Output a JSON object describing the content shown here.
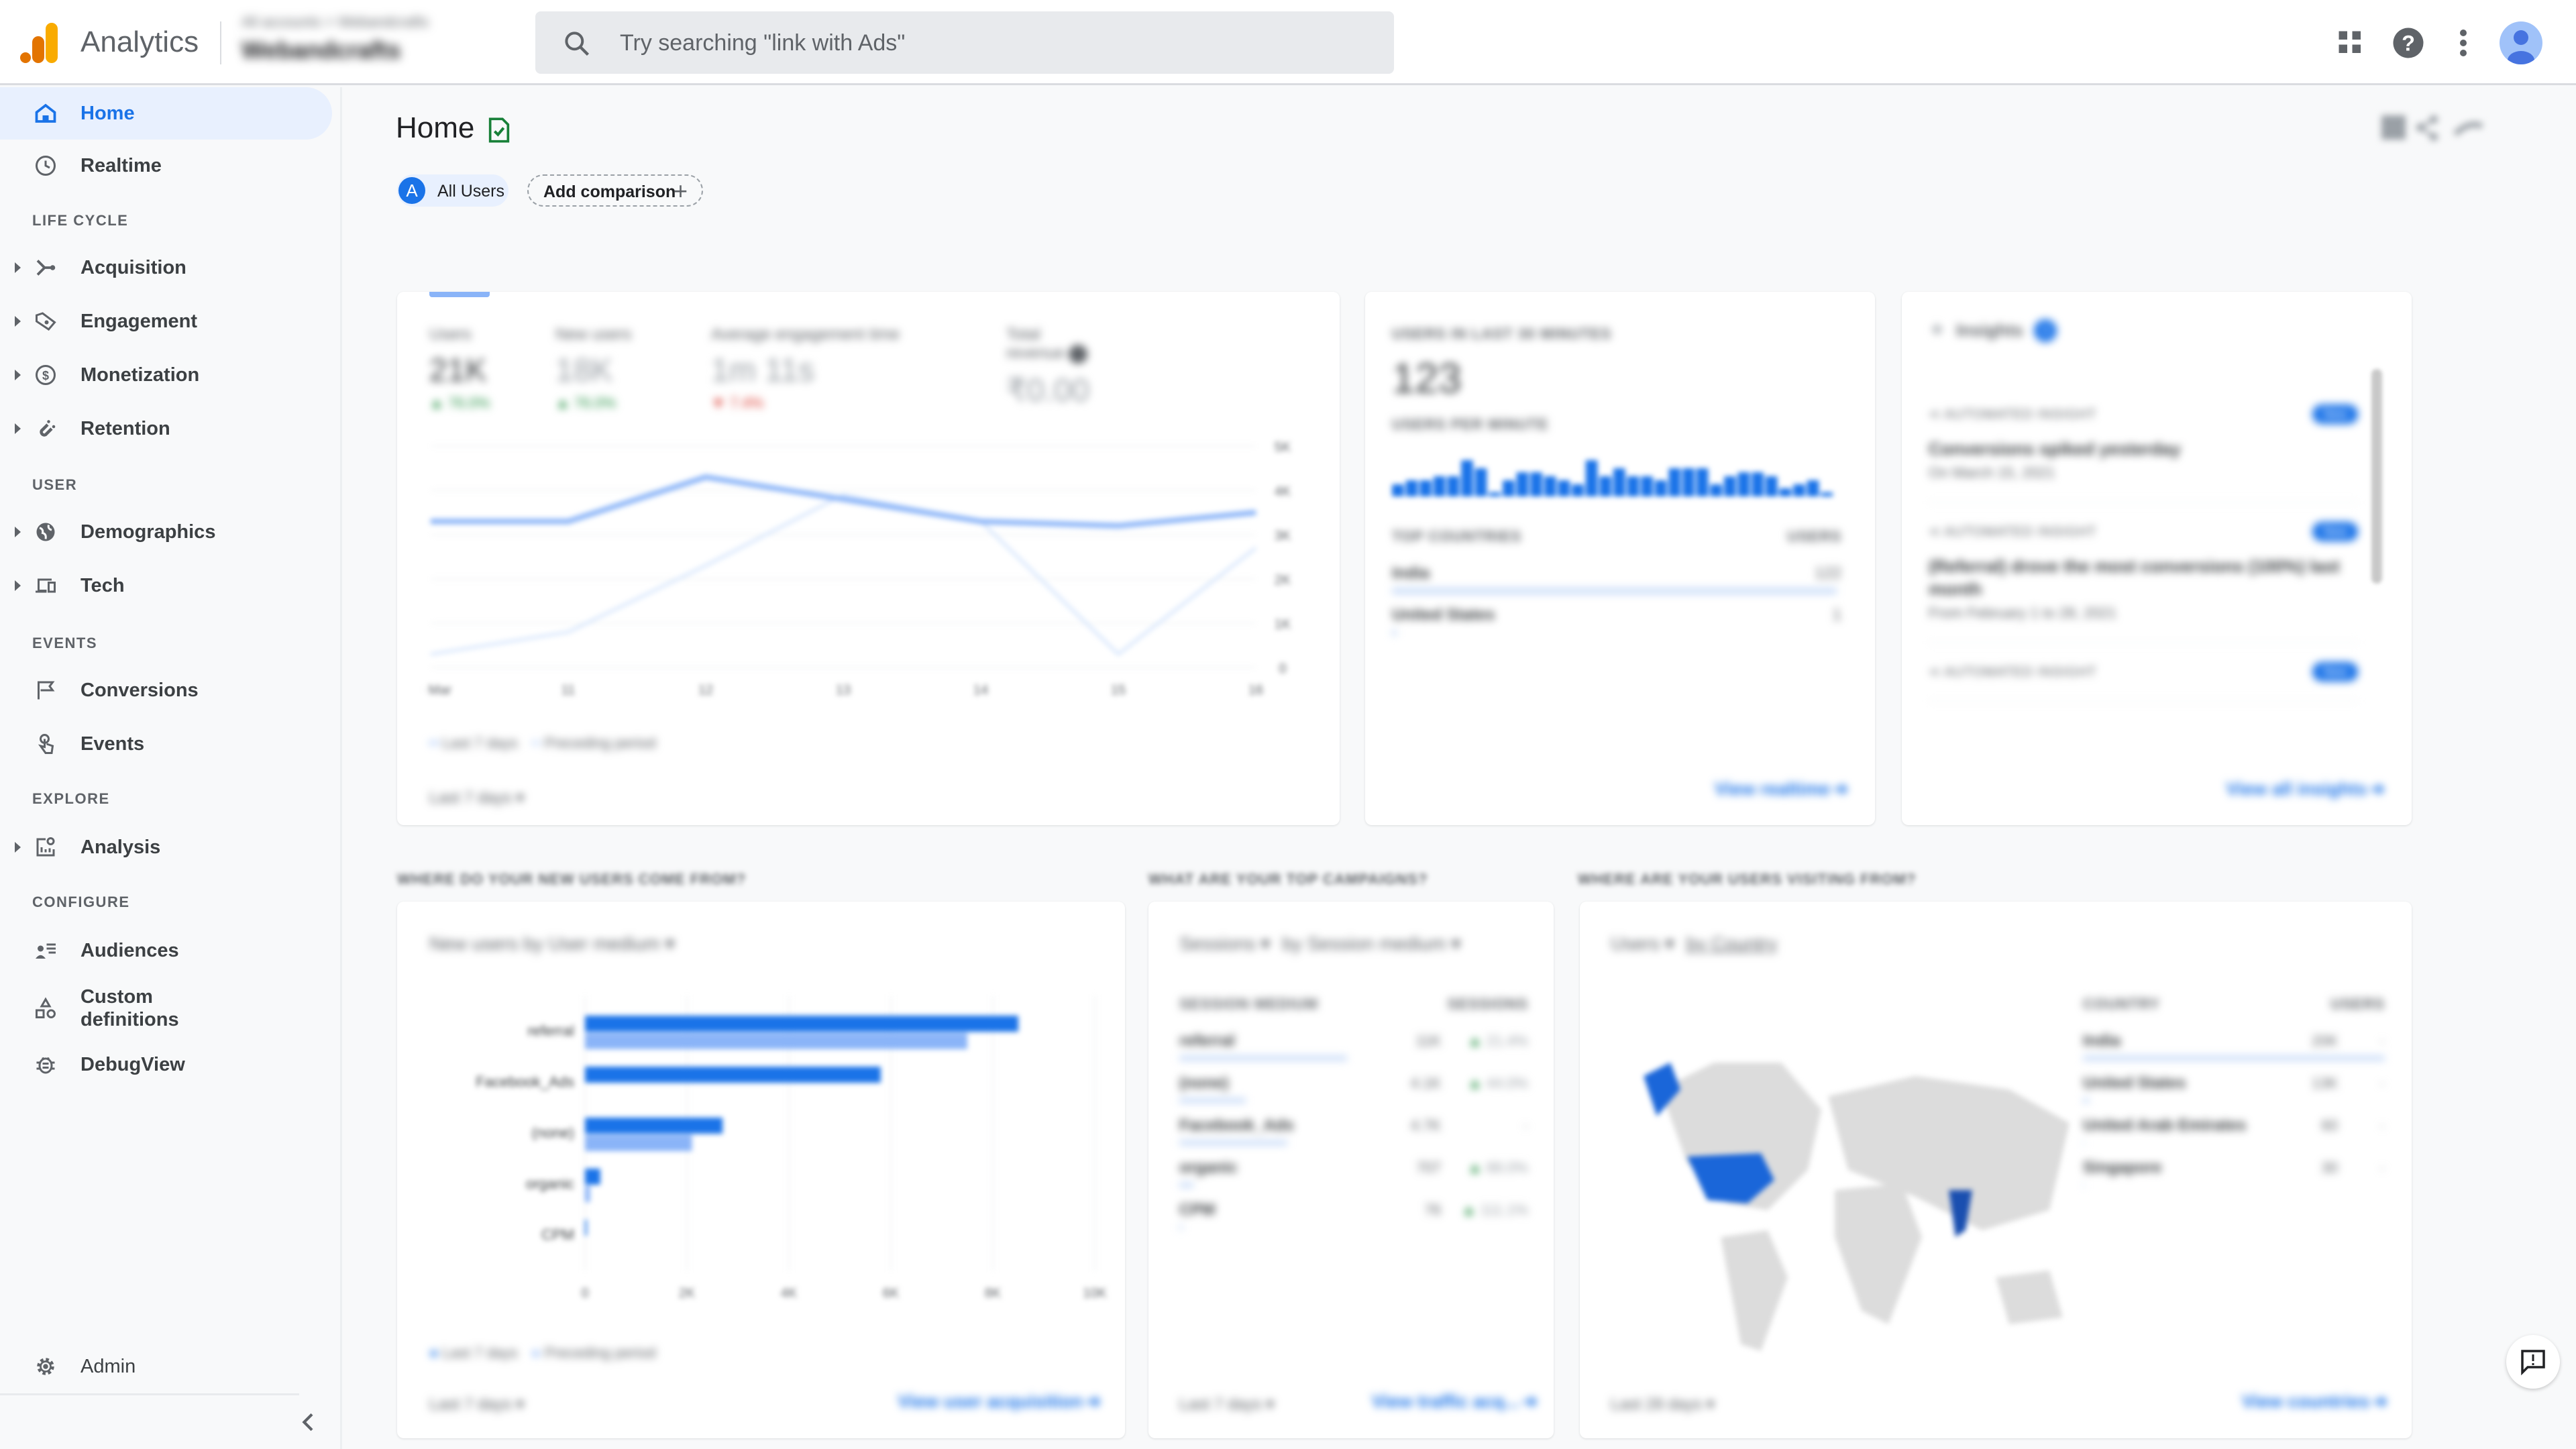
{
  "topbar": {
    "app_name": "Analytics",
    "account_path": "All accounts > Webandcrafts",
    "property_name": "Webandcrafts",
    "search_placeholder": "Try searching \"link with Ads\"",
    "icons": [
      "apps-grid-icon",
      "help-icon",
      "more-vert-icon",
      "account-avatar-icon"
    ]
  },
  "sidebar": {
    "items": [
      {
        "label": "Home",
        "icon": "home-icon",
        "active": true,
        "expandable": false
      },
      {
        "label": "Realtime",
        "icon": "clock-icon",
        "expandable": false
      }
    ],
    "sections": [
      {
        "heading": "LIFE CYCLE",
        "items": [
          {
            "label": "Acquisition",
            "icon": "acquisition-icon",
            "expandable": true
          },
          {
            "label": "Engagement",
            "icon": "tag-heart-icon",
            "expandable": true
          },
          {
            "label": "Monetization",
            "icon": "dollar-icon",
            "expandable": true
          },
          {
            "label": "Retention",
            "icon": "magnet-icon",
            "expandable": true
          }
        ]
      },
      {
        "heading": "USER",
        "items": [
          {
            "label": "Demographics",
            "icon": "globe-icon",
            "expandable": true
          },
          {
            "label": "Tech",
            "icon": "devices-icon",
            "expandable": true
          }
        ]
      },
      {
        "heading": "EVENTS",
        "items": [
          {
            "label": "Conversions",
            "icon": "flag-icon",
            "expandable": false
          },
          {
            "label": "Events",
            "icon": "touch-icon",
            "expandable": false
          }
        ]
      },
      {
        "heading": "EXPLORE",
        "items": [
          {
            "label": "Analysis",
            "icon": "analysis-icon",
            "expandable": true
          }
        ]
      },
      {
        "heading": "CONFIGURE",
        "items": [
          {
            "label": "Audiences",
            "icon": "audiences-icon",
            "expandable": false
          },
          {
            "label": "Custom definitions",
            "icon": "shapes-icon",
            "expandable": false
          },
          {
            "label": "DebugView",
            "icon": "bug-icon",
            "expandable": false
          }
        ]
      }
    ],
    "admin_label": "Admin"
  },
  "main": {
    "title": "Home",
    "segment_chip": {
      "letter": "A",
      "label": "All Users"
    },
    "add_comparison_label": "Add comparison",
    "overview_card": {
      "metrics": [
        {
          "label": "Users",
          "value": "21K",
          "change": "76.0%",
          "direction": "up"
        },
        {
          "label": "New users",
          "value": "18K",
          "change": "76.0%",
          "direction": "up"
        },
        {
          "label": "Average engagement time",
          "value": "1m 11s",
          "change": "7.4%",
          "direction": "down"
        },
        {
          "label": "Total revenue",
          "value": "₹0.00",
          "change": "",
          "direction": ""
        }
      ],
      "date_range": "Last 7 days"
    },
    "realtime_card": {
      "heading": "USERS IN LAST 30 MINUTES",
      "value": "123",
      "per_minute_heading": "USERS PER MINUTE",
      "countries_heading": "TOP COUNTRIES",
      "users_heading": "USERS",
      "countries": [
        {
          "name": "India",
          "users": "122",
          "share": 0.99
        },
        {
          "name": "United States",
          "users": "1",
          "share": 0.01
        }
      ],
      "link": "View realtime"
    },
    "insights_card": {
      "title": "Insights",
      "badge": "3",
      "items": [
        {
          "type": "AUTOMATED INSIGHT",
          "badge": "New",
          "title": "Conversions spiked yesterday",
          "subtitle": "On March 15, 2021"
        },
        {
          "type": "AUTOMATED INSIGHT",
          "badge": "New",
          "title": "(Referral) drove the most conversions (100%) last month",
          "subtitle": "From February 1 to 28, 2021"
        },
        {
          "type": "AUTOMATED INSIGHT",
          "badge": "New",
          "title": "",
          "subtitle": ""
        }
      ],
      "link": "View all insights"
    },
    "acquisition": {
      "question": "WHERE DO YOUR NEW USERS COME FROM?",
      "card_title": "New users by User medium",
      "date_range": "Last 7 days",
      "link": "View user acquisition"
    },
    "campaigns": {
      "question": "WHAT ARE YOUR TOP CAMPAIGNS?",
      "metric_selector": "Sessions",
      "dimension_selector": "by Session medium",
      "col_medium": "SESSION MEDIUM",
      "col_sessions": "SESSIONS",
      "rows": [
        {
          "medium": "referral",
          "sessions": "11K",
          "change": "21.4%",
          "share": 0.48
        },
        {
          "medium": "(none)",
          "sessions": "4.1K",
          "change": "44.0%",
          "share": 0.19
        },
        {
          "medium": "Facebook_Ads",
          "sessions": "4.7K",
          "change": "-",
          "share": 0.31
        },
        {
          "medium": "organic",
          "sessions": "707",
          "change": "88.0%",
          "share": 0.04
        },
        {
          "medium": "CPM",
          "sessions": "76",
          "change": "111.1%",
          "share": 0.01
        }
      ],
      "date_range": "Last 7 days",
      "link": "View traffic acq..."
    },
    "countries": {
      "question": "WHERE ARE YOUR USERS VISITING FROM?",
      "metric_selector": "Users",
      "dimension_selector": "by Country",
      "col_country": "COUNTRY",
      "col_users": "USERS",
      "rows": [
        {
          "country": "India",
          "users": "20K",
          "change": "-",
          "share": 1.0
        },
        {
          "country": "United States",
          "users": "13K",
          "change": "-",
          "share": 0.02
        },
        {
          "country": "United Arab Emirates",
          "users": "60",
          "change": "-",
          "share": 0.0
        },
        {
          "country": "Singapore",
          "users": "30",
          "change": "-",
          "share": 0.0
        }
      ],
      "date_range": "Last 28 days",
      "link": "View countries"
    },
    "colors": {
      "accent": "#1a73e8",
      "accent_light": "#8ab4f8",
      "up": "#1e8e3e",
      "down": "#d93025"
    }
  },
  "chart_data": [
    {
      "type": "line",
      "title": "Users over time",
      "x": [
        "10 Mar",
        "11",
        "12",
        "13",
        "14",
        "15",
        "16"
      ],
      "series": [
        {
          "name": "Last 7 days",
          "values": [
            3.3,
            3.3,
            4.3,
            3.8,
            3.3,
            3.2,
            3.5
          ]
        },
        {
          "name": "Preceding period",
          "values": [
            0.3,
            0.8,
            2.3,
            3.9,
            3.3,
            0.3,
            2.7
          ]
        }
      ],
      "ylim": [
        0,
        5
      ],
      "yticks": [
        "0",
        "1K",
        "2K",
        "3K",
        "4K",
        "5K"
      ],
      "legend": "bottom-left",
      "grid": true
    },
    {
      "type": "bar",
      "title": "Users per minute",
      "values": [
        3,
        4,
        4,
        5,
        5,
        9,
        7,
        1,
        4,
        6,
        6,
        5,
        4,
        3,
        9,
        5,
        7,
        5,
        5,
        4,
        7,
        7,
        7,
        3,
        5,
        6,
        6,
        5,
        2,
        3,
        4,
        1
      ],
      "ylim": [
        0,
        10
      ]
    },
    {
      "type": "bar",
      "orientation": "horizontal",
      "title": "New users by User medium",
      "categories": [
        "referral",
        "Facebook_Ads",
        "(none)",
        "organic",
        "CPM"
      ],
      "series": [
        {
          "name": "Last 7 days",
          "values": [
            85,
            58,
            27,
            3,
            0.3
          ]
        },
        {
          "name": "Preceding period",
          "values": [
            75,
            0,
            21,
            1,
            0
          ]
        }
      ],
      "xlim": [
        0,
        100
      ],
      "xticks": [
        "0",
        "2K",
        "4K",
        "6K",
        "8K",
        "10K"
      ],
      "legend": "bottom-left"
    },
    {
      "type": "heatmap",
      "title": "Users by Country",
      "regions": [
        {
          "name": "India",
          "intensity": 1.0
        },
        {
          "name": "United States",
          "intensity": 0.7
        },
        {
          "name": "Alaska",
          "intensity": 0.7
        }
      ]
    }
  ]
}
